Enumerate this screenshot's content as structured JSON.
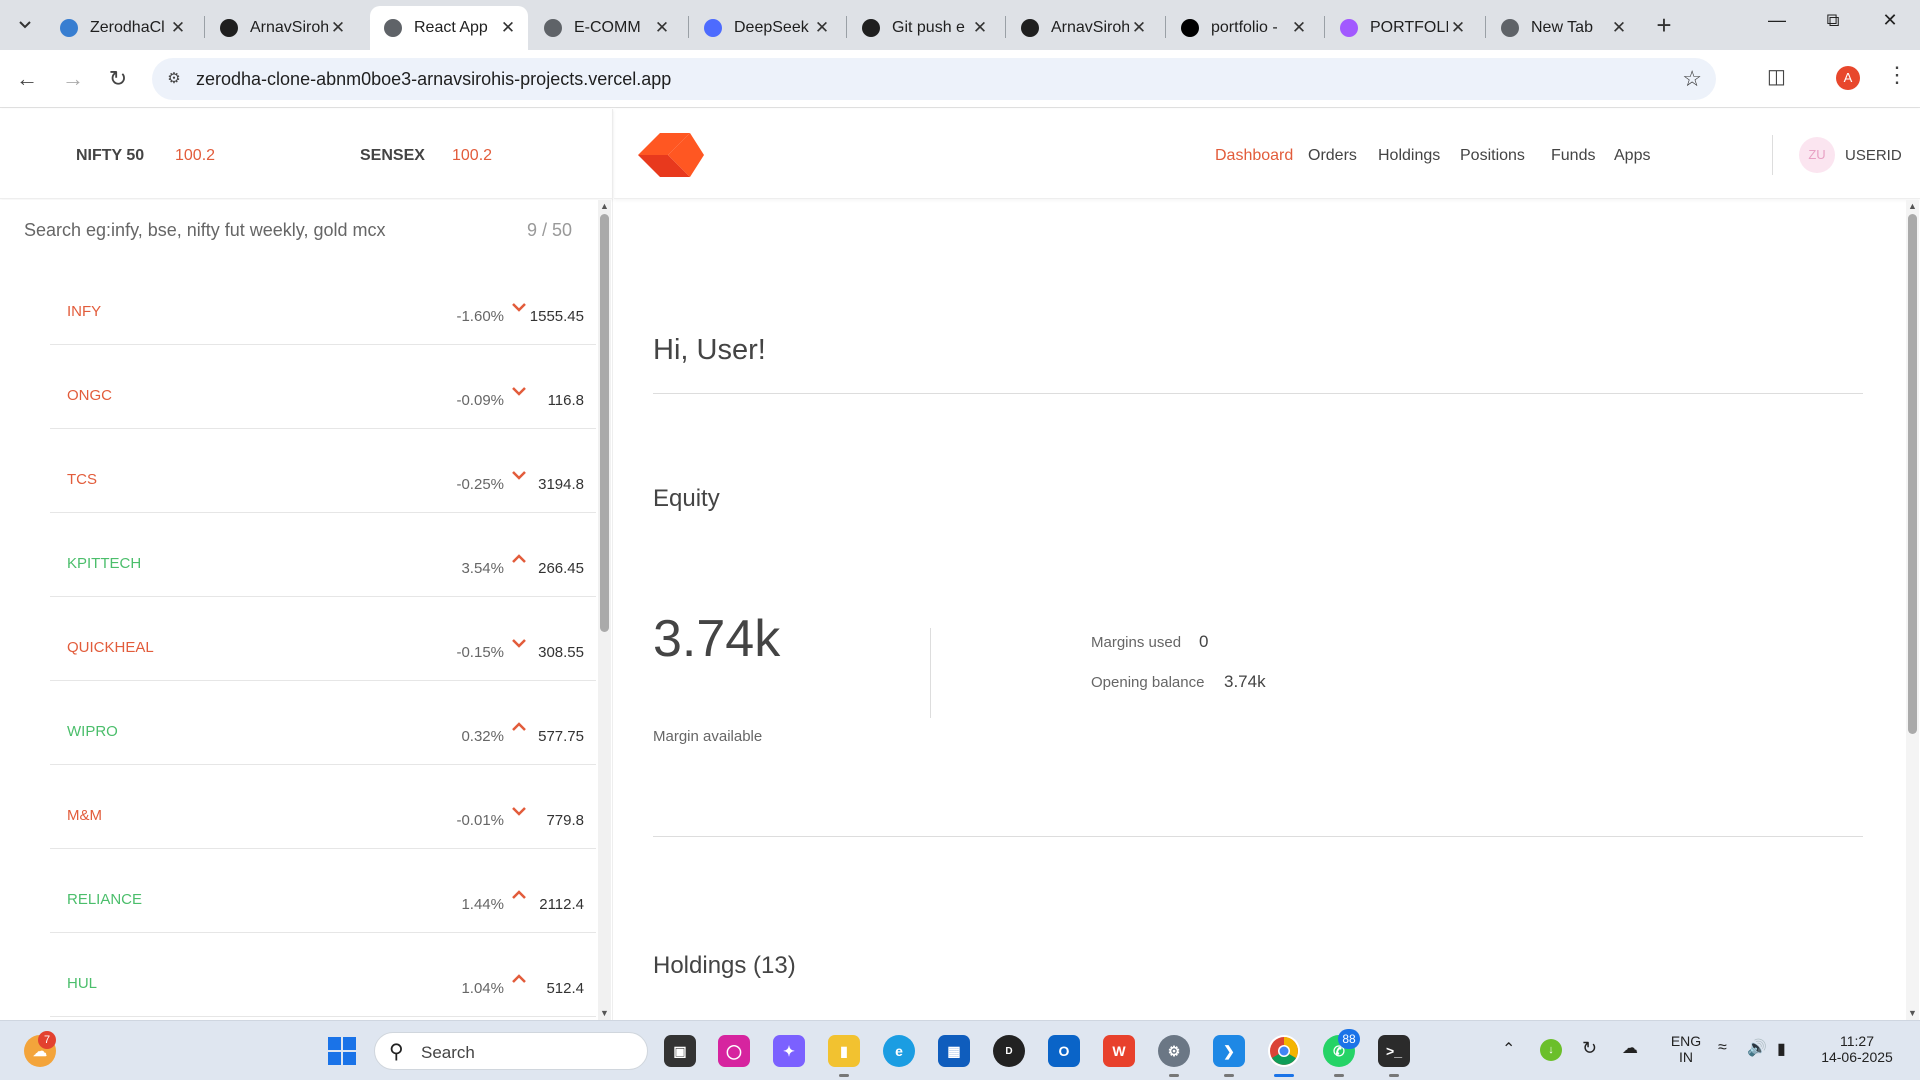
{
  "browser": {
    "tabs": [
      {
        "label": "ZerodhaCl",
        "favicon": "zerodha-favicon-icon",
        "color": "#387ed1"
      },
      {
        "label": "ArnavSiroh",
        "favicon": "github-icon",
        "color": "#1f1f1f"
      },
      {
        "label": "React App",
        "favicon": "globe-icon",
        "color": "#5f6368",
        "active": true
      },
      {
        "label": "E-COMM",
        "favicon": "globe-icon",
        "color": "#5f6368"
      },
      {
        "label": "DeepSeek",
        "favicon": "deepseek-icon",
        "color": "#4d6bfe"
      },
      {
        "label": "Git push e",
        "favicon": "chatgpt-icon",
        "color": "#1f1f1f"
      },
      {
        "label": "ArnavSiroh",
        "favicon": "github-icon",
        "color": "#1f1f1f"
      },
      {
        "label": "portfolio -",
        "favicon": "vercel-icon",
        "color": "#000000"
      },
      {
        "label": "PORTFOLIO",
        "favicon": "vite-icon",
        "color": "#a259ff"
      },
      {
        "label": "New Tab",
        "favicon": "chrome-icon",
        "color": "#5f6368"
      }
    ],
    "url": "zerodha-clone-abnm0boe3-arnavsirohis-projects.vercel.app",
    "profile_initial": "A"
  },
  "indices": [
    {
      "name": "NIFTY 50",
      "value": "100.2"
    },
    {
      "name": "SENSEX",
      "value": "100.2"
    }
  ],
  "search": {
    "placeholder": "Search eg:infy, bse, nifty fut weekly, gold mcx",
    "count": "9 / 50"
  },
  "watchlist": [
    {
      "name": "INFY",
      "percent": "-1.60%",
      "price": "1555.45",
      "direction": "down"
    },
    {
      "name": "ONGC",
      "percent": "-0.09%",
      "price": "116.8",
      "direction": "down"
    },
    {
      "name": "TCS",
      "percent": "-0.25%",
      "price": "3194.8",
      "direction": "down"
    },
    {
      "name": "KPITTECH",
      "percent": "3.54%",
      "price": "266.45",
      "direction": "up"
    },
    {
      "name": "QUICKHEAL",
      "percent": "-0.15%",
      "price": "308.55",
      "direction": "down"
    },
    {
      "name": "WIPRO",
      "percent": "0.32%",
      "price": "577.75",
      "direction": "up"
    },
    {
      "name": "M&M",
      "percent": "-0.01%",
      "price": "779.8",
      "direction": "down"
    },
    {
      "name": "RELIANCE",
      "percent": "1.44%",
      "price": "2112.4",
      "direction": "up"
    },
    {
      "name": "HUL",
      "percent": "1.04%",
      "price": "512.4",
      "direction": "up"
    }
  ],
  "nav": {
    "items": [
      "Dashboard",
      "Orders",
      "Holdings",
      "Positions",
      "Funds",
      "Apps"
    ],
    "active": "Dashboard",
    "avatar": "ZU",
    "user_id": "USERID"
  },
  "dashboard": {
    "greeting": "Hi, User!",
    "equity_title": "Equity",
    "margin_available_value": "3.74k",
    "margin_available_label": "Margin available",
    "margins_used_label": "Margins used",
    "margins_used_value": "0",
    "opening_balance_label": "Opening balance",
    "opening_balance_value": "3.74k",
    "holdings_title": "Holdings (13)"
  },
  "colors": {
    "accent": "#e25c3b",
    "down": "#e25c3b",
    "up": "#4bbe6b"
  },
  "taskbar": {
    "search_label": "Search",
    "widget_badge": "7",
    "whatsapp_badge": "88",
    "language": "ENG",
    "region": "IN",
    "time": "11:27",
    "date": "14-06-2025"
  }
}
